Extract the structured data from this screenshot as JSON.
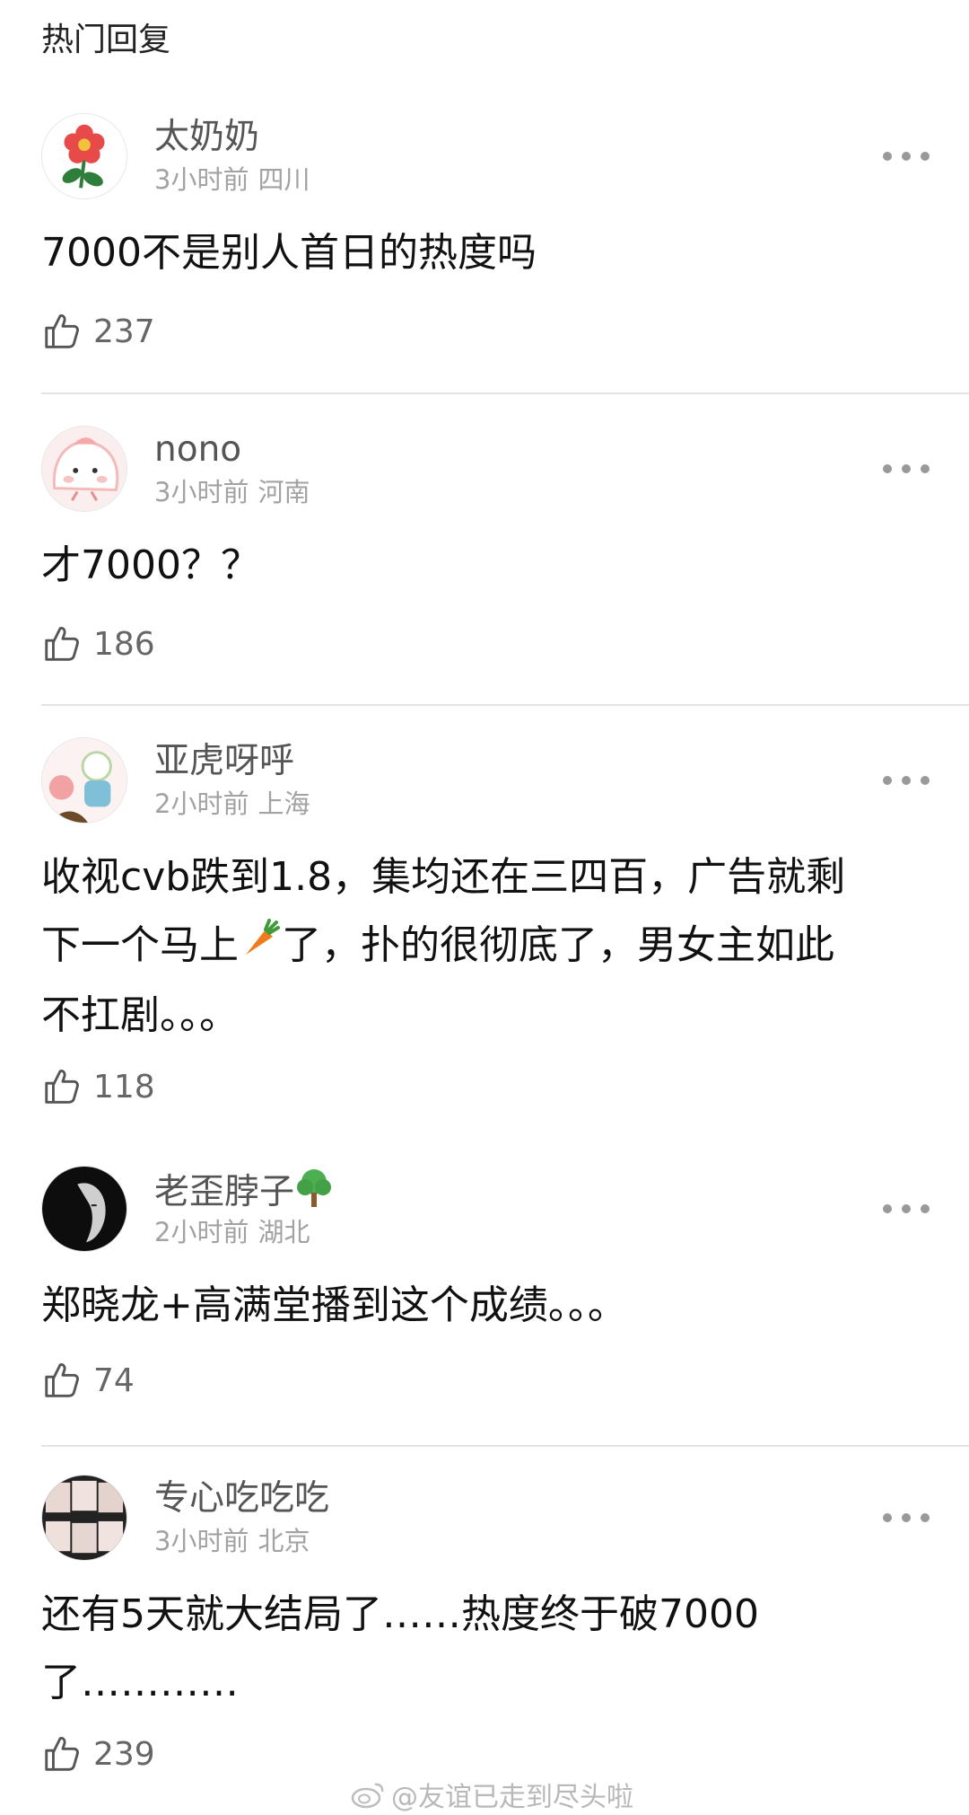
{
  "section_title": "热门回复",
  "comments": [
    {
      "username": "太奶奶",
      "time": "3小时前",
      "location": "四川",
      "text": "7000不是别人首日的热度吗",
      "likes": "237"
    },
    {
      "username": "nono",
      "time": "3小时前",
      "location": "河南",
      "text": "才7000？？",
      "likes": "186"
    },
    {
      "username": "亚虎呀呼",
      "time": "2小时前",
      "location": "上海",
      "text_line1": "收视cvb跌到1.8，集均还在三四百，广告就剩",
      "text_line2a": "下一个马上",
      "text_line2b": "了，扑的很彻底了，男女主如此",
      "text_line3": "不扛剧。。。",
      "likes": "118"
    },
    {
      "username": "老歪脖子",
      "time": "2小时前",
      "location": "湖北",
      "text": "郑晓龙+高满堂播到这个成绩。。。",
      "likes": "74"
    },
    {
      "username": "专心吃吃吃",
      "time": "3小时前",
      "location": "北京",
      "text_line1": "还有5天就大结局了……热度终于破7000",
      "text_line2": "了…………",
      "likes": "239"
    }
  ],
  "watermark": "@友谊已走到尽头啦"
}
